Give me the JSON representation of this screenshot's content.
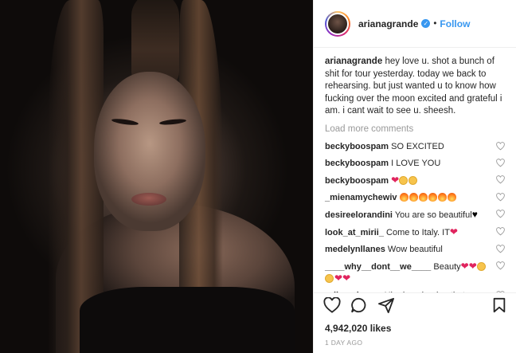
{
  "post": {
    "username": "arianagrande",
    "verified": true,
    "follow_label": "Follow",
    "separator": "•",
    "caption": "hey love u. shot a bunch of shit for tour yesterday. today we back to rehearsing. but just wanted u to know how fucking over the moon excited and grateful i am. i cant wait to see u. sheesh.",
    "load_more": "Load more comments",
    "comments": [
      {
        "user": "beckyboospam",
        "text": "SO EXCITED"
      },
      {
        "user": "beckyboospam",
        "text": "I LOVE YOU"
      },
      {
        "user": "beckyboospam",
        "text": "",
        "emojis": [
          "heart",
          "face",
          "face"
        ]
      },
      {
        "user": "_mienamychewiv",
        "text": "",
        "emojis": [
          "fire",
          "fire",
          "fire",
          "fire",
          "fire",
          "fire"
        ]
      },
      {
        "user": "desireelorandini",
        "text": "You are so beautiful",
        "emojis": [
          "black-heart"
        ]
      },
      {
        "user": "look_at_mirii_",
        "text": "Come to Italy. IT",
        "emojis": [
          "heart"
        ]
      },
      {
        "user": "medelynllanes",
        "text": "Wow beautiful"
      },
      {
        "user": "____why__dont__we____",
        "text": "Beauty",
        "emojis": [
          "heart",
          "heart",
          "face",
          "face",
          "heart",
          "heart"
        ]
      },
      {
        "user": "orliemulacruz",
        "text": "Hi ariana hoping that"
      }
    ],
    "likes": "4,942,020 likes",
    "date": "1 DAY AGO"
  },
  "icons": {
    "like": "heart-outline-icon",
    "comment": "speech-bubble-icon",
    "share": "share-arrow-icon",
    "save": "bookmark-icon"
  },
  "colors": {
    "link_blue": "#3897f0",
    "muted": "#999999",
    "text": "#262626"
  }
}
